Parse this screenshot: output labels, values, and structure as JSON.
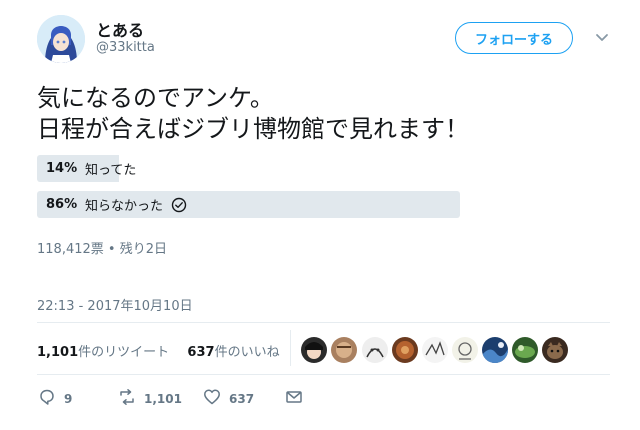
{
  "user": {
    "name": "とある",
    "handle": "@33kitta"
  },
  "follow_label": "フォローする",
  "tweet": {
    "line1": "気になるのでアンケ。",
    "line2": "日程が合えばジブリ博物館で見れます！"
  },
  "poll": {
    "options": [
      {
        "percent_label": "14%",
        "label": "知ってた",
        "percent": 14,
        "selected": false
      },
      {
        "percent_label": "86%",
        "label": "知らなかった",
        "percent": 86,
        "selected": true
      }
    ],
    "meta": "118,412票 • 残り2日"
  },
  "timestamp": "22:13 - 2017年10月10日",
  "stats": {
    "retweets_count": "1,101",
    "retweets_label": "件のリツイート",
    "likes_count": "637",
    "likes_label": "件のいいね"
  },
  "actions": {
    "reply_count": "9",
    "retweet_count": "1,101",
    "like_count": "637"
  },
  "colors": {
    "accent": "#1da1f2",
    "muted": "#657786",
    "poll_bar": "#e1e8ed"
  },
  "icons": [
    "reply-icon",
    "retweet-icon",
    "heart-icon",
    "mail-icon",
    "chevron-down-icon",
    "check-circle-icon"
  ]
}
